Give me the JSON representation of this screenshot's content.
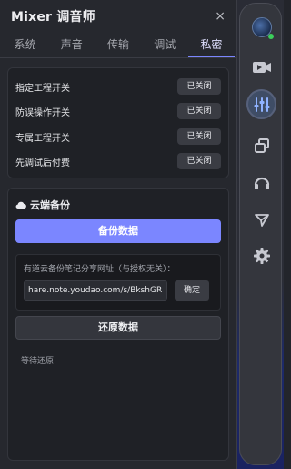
{
  "app": {
    "title": "Mixer 调音师",
    "close_glyph": "×"
  },
  "tabs": [
    {
      "label": "系统"
    },
    {
      "label": "声音"
    },
    {
      "label": "传输"
    },
    {
      "label": "调试"
    },
    {
      "label": "私密",
      "active": true
    }
  ],
  "privacy": {
    "rows": [
      {
        "label": "指定工程开关",
        "state": "已关闭"
      },
      {
        "label": "防误操作开关",
        "state": "已关闭"
      },
      {
        "label": "专属工程开关",
        "state": "已关闭"
      },
      {
        "label": "先调试后付费",
        "state": "已关闭"
      }
    ]
  },
  "cloud": {
    "icon": "cloud-icon",
    "title": "云端备份",
    "backup_label": "备份数据",
    "share_label": "有道云备份笔记分享网址（与授权无关）：",
    "share_value": "hare.note.youdao.com/s/BkshGRbR",
    "confirm_label": "确定",
    "restore_label": "还原数据",
    "status": "等待还原"
  },
  "sidebar": {
    "icons": [
      "avatar-icon",
      "video-icon",
      "mixer-sliders-icon",
      "windows-icon",
      "headset-icon",
      "send-icon",
      "settings-gear-icon"
    ]
  },
  "colors": {
    "accent": "#7b86ff",
    "online": "#3ccf5b"
  }
}
